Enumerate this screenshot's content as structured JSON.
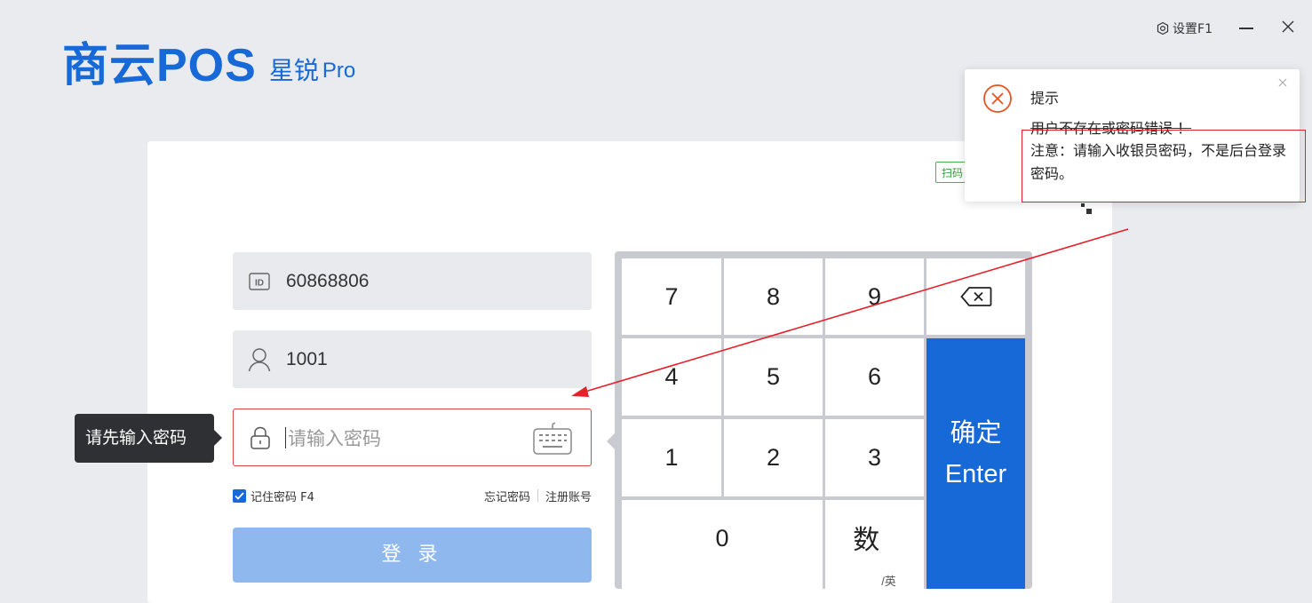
{
  "app": {
    "logo_main": "商云POS",
    "logo_sub": "星锐",
    "logo_pro": "Pro"
  },
  "window": {
    "settings_label": "设置F1"
  },
  "login": {
    "store_id": "60868806",
    "username": "1001",
    "password_placeholder": "请输入密码",
    "error_tip": "请先输入密码",
    "remember_label": "记住密码 F4",
    "forgot_label": "忘记密码",
    "register_label": "注册账号",
    "login_button": "登 录",
    "scan_tag": "扫码"
  },
  "keypad": {
    "keys": [
      "7",
      "8",
      "9",
      "4",
      "5",
      "6",
      "1",
      "2",
      "3",
      "0"
    ],
    "enter_line1": "确定",
    "enter_line2": "Enter",
    "lang_main": "数",
    "lang_sub": "/英"
  },
  "notification": {
    "title": "提示",
    "line1": "用户不存在或密码错误 ！",
    "line2": "注意：请输入收银员密码，不是后台登录密码。"
  },
  "colors": {
    "accent": "#1769d8",
    "error": "#e24343",
    "annotation": "#e5202b"
  }
}
